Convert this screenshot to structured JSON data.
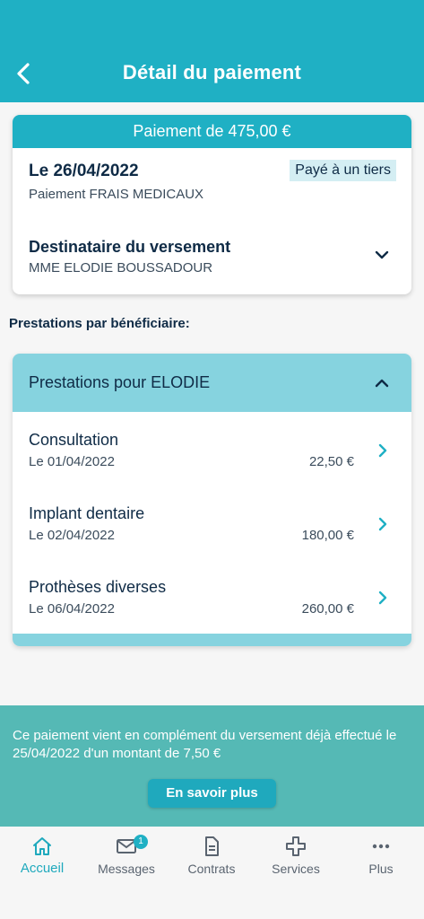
{
  "header": {
    "title": "Détail du paiement"
  },
  "payment": {
    "banner": "Paiement de 475,00 €",
    "date": "Le 26/04/2022",
    "badge": "Payé à un tiers",
    "type": "Paiement FRAIS MEDICAUX",
    "recipient_title": "Destinataire du versement",
    "recipient_name": "MME ELODIE BOUSSADOUR"
  },
  "section_label": "Prestations par bénéficiaire:",
  "beneficiary": {
    "header": "Prestations pour ELODIE",
    "items": [
      {
        "title": "Consultation",
        "date": "Le 01/04/2022",
        "amount": "22,50 €"
      },
      {
        "title": "Implant dentaire",
        "date": "Le 02/04/2022",
        "amount": "180,00 €"
      },
      {
        "title": "Prothèses diverses",
        "date": "Le 06/04/2022",
        "amount": "260,00 €"
      }
    ]
  },
  "info": {
    "text": "Ce paiement vient en complément du versement déjà effectué le 25/04/2022 d'un montant de 7,50 €",
    "button": "En savoir plus"
  },
  "tabs": [
    {
      "label": "Accueil",
      "icon": "home-icon",
      "active": true
    },
    {
      "label": "Messages",
      "icon": "mail-icon",
      "badge": "1"
    },
    {
      "label": "Contrats",
      "icon": "document-icon"
    },
    {
      "label": "Services",
      "icon": "medical-cross-icon"
    },
    {
      "label": "Plus",
      "icon": "more-icon"
    }
  ],
  "colors": {
    "primary": "#1fb0c4",
    "light": "#86d3df",
    "info_bg": "#55b9b5",
    "text": "#0f2b46"
  }
}
